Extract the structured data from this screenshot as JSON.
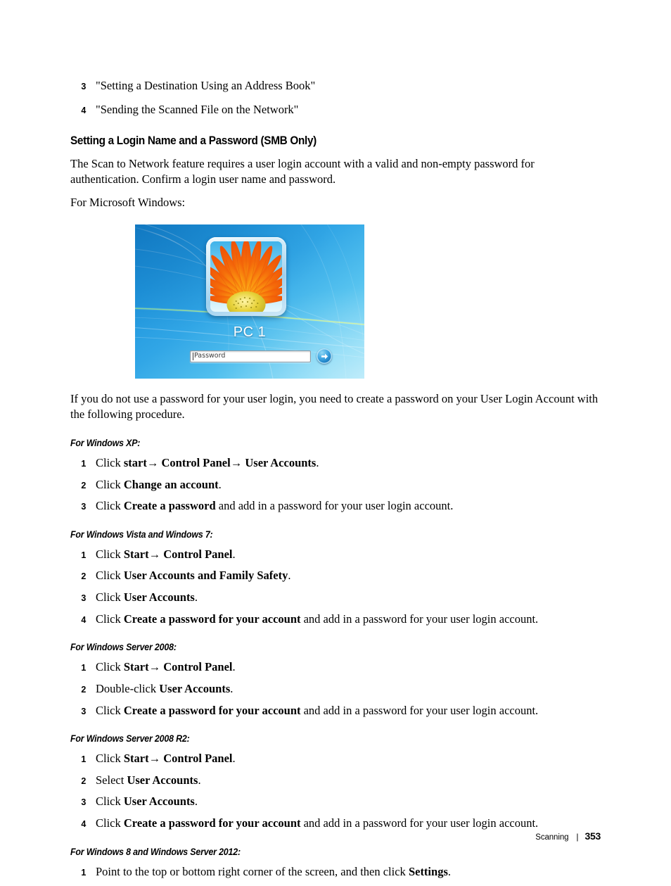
{
  "intro_list": [
    {
      "num": "3",
      "text": "\"Setting a Destination Using an Address Book\""
    },
    {
      "num": "4",
      "text": "\"Sending the Scanned File on the Network\""
    }
  ],
  "section": {
    "heading": "Setting a Login Name and a Password (SMB Only)",
    "paragraph_1": "The Scan to Network feature requires a user login account with a valid and non-empty password for authentication. Confirm a login user name and password.",
    "paragraph_2": "For Microsoft Windows:",
    "paragraph_3": "If you do not use a password for your user login, you need to create a password on your User Login Account with the following procedure."
  },
  "login_screenshot": {
    "user_name": "PC 1",
    "password_placeholder": "Password",
    "submit_icon": "arrow-right-icon",
    "avatar_icon": "flower-avatar-icon"
  },
  "subsections": [
    {
      "heading": "For Windows XP:",
      "steps": [
        {
          "num": "1",
          "pre": "Click ",
          "bold": "start",
          "mid": "→ ",
          "bold2": "Control Panel",
          "mid2": "→ ",
          "bold3": "User Accounts",
          "post": "."
        },
        {
          "num": "2",
          "pre": "Click ",
          "bold": "Change an account",
          "post": "."
        },
        {
          "num": "3",
          "pre": "Click ",
          "bold": "Create a password",
          "post": " and add in a password for your user login account."
        }
      ]
    },
    {
      "heading": "For Windows Vista and Windows 7:",
      "steps": [
        {
          "num": "1",
          "pre": "Click ",
          "bold": "Start",
          "mid": "→ ",
          "bold2": "Control Panel",
          "post": "."
        },
        {
          "num": "2",
          "pre": "Click ",
          "bold": "User Accounts and Family Safety",
          "post": "."
        },
        {
          "num": "3",
          "pre": "Click ",
          "bold": "User Accounts",
          "post": "."
        },
        {
          "num": "4",
          "pre": "Click ",
          "bold": "Create a password for your account",
          "post": " and add in a password for your user login account."
        }
      ]
    },
    {
      "heading": "For Windows Server 2008:",
      "steps": [
        {
          "num": "1",
          "pre": "Click ",
          "bold": "Start",
          "mid": "→ ",
          "bold2": "Control Panel",
          "post": "."
        },
        {
          "num": "2",
          "pre": "Double-click ",
          "bold": "User Accounts",
          "post": "."
        },
        {
          "num": "3",
          "pre": "Click ",
          "bold": "Create a password for your account",
          "post": " and add in a password for your user login account."
        }
      ]
    },
    {
      "heading": "For Windows Server 2008 R2:",
      "steps": [
        {
          "num": "1",
          "pre": "Click ",
          "bold": "Start",
          "mid": "→ ",
          "bold2": "Control Panel",
          "post": "."
        },
        {
          "num": "2",
          "pre": "Select ",
          "bold": "User Accounts",
          "post": "."
        },
        {
          "num": "3",
          "pre": "Click ",
          "bold": "User Accounts",
          "post": "."
        },
        {
          "num": "4",
          "pre": "Click ",
          "bold": "Create a password for your account",
          "post": " and add in a password for your user login account."
        }
      ]
    },
    {
      "heading": "For Windows 8 and Windows Server 2012:",
      "steps": [
        {
          "num": "1",
          "pre": "Point to the top or bottom right corner of the screen, and then click ",
          "bold": "Settings",
          "post": "."
        }
      ]
    }
  ],
  "footer": {
    "section_name": "Scanning",
    "separator": "|",
    "page_number": "353"
  }
}
